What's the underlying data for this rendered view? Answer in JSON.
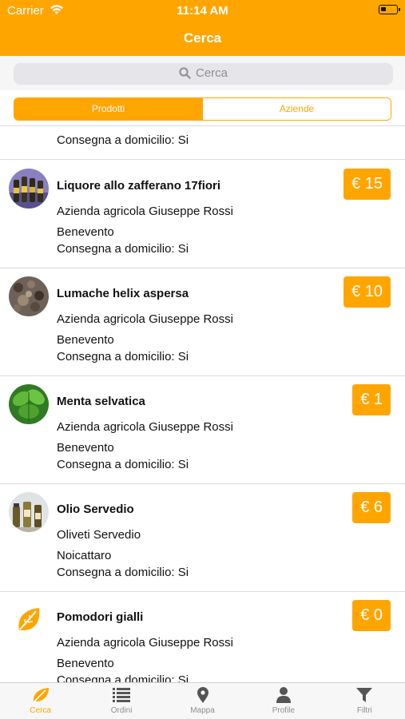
{
  "status_bar": {
    "carrier": "Carrier",
    "time": "11:14 AM"
  },
  "nav": {
    "title": "Cerca"
  },
  "search": {
    "placeholder": "Cerca"
  },
  "segments": {
    "products": "Prodotti",
    "companies": "Aziende"
  },
  "partial_row": {
    "delivery": "Consegna a domicilio: Si"
  },
  "products": [
    {
      "name": "Liquore allo zafferano 17fiori",
      "company": "Azienda agricola Giuseppe Rossi",
      "city": "Benevento",
      "delivery": "Consegna a domicilio: Si",
      "price": "€ 15",
      "thumb_icon": "liquor-bottles-photo"
    },
    {
      "name": "Lumache helix aspersa",
      "company": "Azienda agricola Giuseppe Rossi",
      "city": "Benevento",
      "delivery": "Consegna a domicilio: Si",
      "price": "€ 10",
      "thumb_icon": "snails-photo"
    },
    {
      "name": "Menta selvatica",
      "company": "Azienda agricola Giuseppe Rossi",
      "city": "Benevento",
      "delivery": "Consegna a domicilio: Si",
      "price": "€ 1",
      "thumb_icon": "mint-leaves-photo"
    },
    {
      "name": "Olio Servedio",
      "company": "Oliveti Servedio",
      "city": "Noicattaro",
      "delivery": "Consegna a domicilio: Si",
      "price": "€ 6",
      "thumb_icon": "olive-oil-photo"
    },
    {
      "name": "Pomodori gialli",
      "company": "Azienda agricola Giuseppe Rossi",
      "city": "Benevento",
      "delivery": "Consegna a domicilio: Si",
      "price": "€ 0",
      "thumb_icon": "leaf-logo-icon"
    }
  ],
  "tabs": [
    {
      "label": "Cerca",
      "icon": "leaf-icon"
    },
    {
      "label": "Ordini",
      "icon": "list-icon"
    },
    {
      "label": "Mappa",
      "icon": "map-pin-icon"
    },
    {
      "label": "Profile",
      "icon": "person-icon"
    },
    {
      "label": "Filtri",
      "icon": "filter-icon"
    }
  ],
  "colors": {
    "accent": "#FFA500",
    "tab_inactive": "#8e8e93"
  }
}
